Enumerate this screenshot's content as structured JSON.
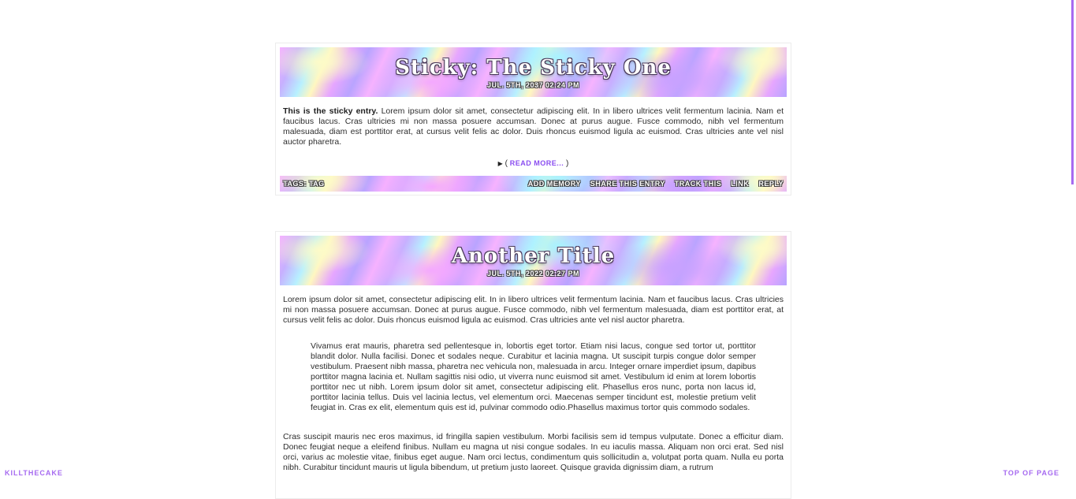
{
  "colors": {
    "accent": "#a66af0",
    "link": "#8a4df0"
  },
  "entries": [
    {
      "title": "Sticky: The Sticky One",
      "date": "JUL. 5TH, 2037 02:24 PM",
      "lead_bold": "This is the sticky entry.",
      "lead_text": " Lorem ipsum dolor sit amet, consectetur adipiscing elit. In in libero ultrices velit fermentum lacinia. Nam et faucibus lacus. Cras ultricies mi non massa posuere accumsan. Donec at purus augue. Fusce commodo, nibh vel fermentum malesuada, diam est porttitor erat, at cursus velit felis ac dolor. Duis rhoncus euismod ligula ac euismod. Cras ultricies ante vel nisl auctor pharetra.",
      "read_more": "READ MORE...",
      "read_more_open": "( ",
      "read_more_close": " )",
      "tags": "TAGS: TAG",
      "actions": [
        "ADD MEMORY",
        "SHARE THIS ENTRY",
        "TRACK THIS",
        "LINK",
        "REPLY"
      ]
    },
    {
      "title": "Another Title",
      "date": "JUL. 5TH, 2022 02:27 PM",
      "para1": "Lorem ipsum dolor sit amet, consectetur adipiscing elit. In in libero ultrices velit fermentum lacinia. Nam et faucibus lacus. Cras ultricies mi non massa posuere accumsan. Donec at purus augue. Fusce commodo, nibh vel fermentum malesuada, diam est porttitor erat, at cursus velit felis ac dolor. Duis rhoncus euismod ligula ac euismod. Cras ultricies ante vel nisl auctor pharetra.",
      "quote": "Vivamus erat mauris, pharetra sed pellentesque in, lobortis eget tortor. Etiam nisi lacus, congue sed tortor ut, porttitor blandit dolor. Nulla facilisi. Donec et sodales neque. Curabitur et lacinia magna. Ut suscipit turpis congue dolor semper vestibulum. Praesent nibh massa, pharetra nec vehicula non, malesuada in arcu. Integer ornare imperdiet ipsum, dapibus porttitor magna lacinia et. Nullam sagittis nisi odio, ut viverra nunc euismod sit amet. Vestibulum id enim at lorem lobortis porttitor nec ut nibh. Lorem ipsum dolor sit amet, consectetur adipiscing elit. Phasellus eros nunc, porta non lacus id, porttitor lacinia tellus. Duis vel lacinia lectus, vel elementum orci. Maecenas semper tincidunt est, molestie pretium velit feugiat in. Cras ex elit, elementum quis est id, pulvinar commodo odio.Phasellus maximus tortor quis commodo sodales.",
      "para2": "Cras suscipit mauris nec eros maximus, id fringilla sapien vestibulum. Morbi facilisis sem id tempus vulputate. Donec a efficitur diam. Donec feugiat neque a eleifend finibus. Nullam eu magna ut nisi congue sodales. In eu iaculis massa. Aliquam non orci erat. Sed nisl orci, varius ac molestie vitae, finibus eget augue. Nam orci lectus, condimentum quis sollicitudin a, volutpat porta quam. Nulla eu porta nibh. Curabitur tincidunt mauris ut ligula bibendum, ut pretium justo laoreet. Quisque gravida dignissim diam, a rutrum"
    }
  ],
  "corner_left": "KILLTHECAKE",
  "corner_right": "TOP OF PAGE"
}
